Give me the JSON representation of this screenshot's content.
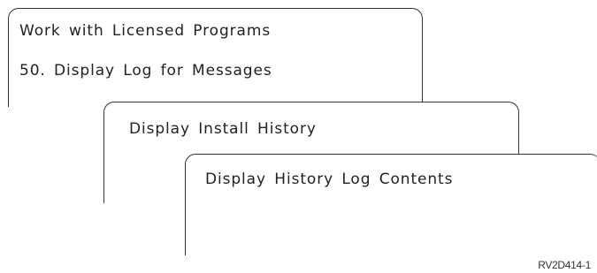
{
  "screens": [
    {
      "lines": [
        "Work with Licensed Programs",
        "50. Display Log for Messages"
      ]
    },
    {
      "lines": [
        "Display Install History"
      ]
    },
    {
      "lines": [
        "Display History Log Contents"
      ]
    }
  ],
  "figure_id": "RV2D414-1",
  "colors": {
    "stroke": "#333333",
    "text": "#222222",
    "background": "#ffffff"
  }
}
